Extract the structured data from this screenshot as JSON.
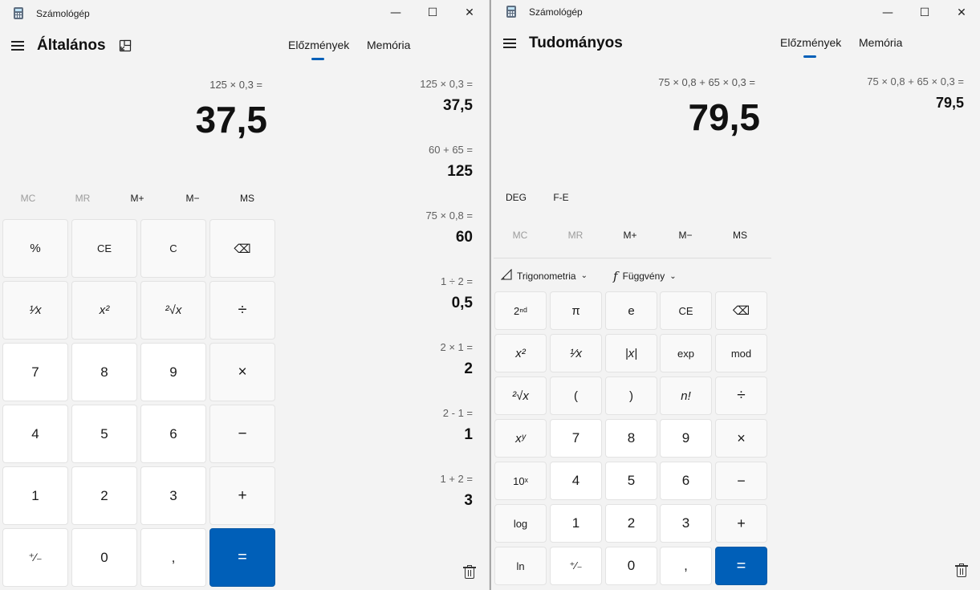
{
  "left": {
    "app_title": "Számológép",
    "mode": "Általános",
    "tabs": [
      "Előzmények",
      "Memória"
    ],
    "expression": "125 × 0,3 =",
    "display": "37,5",
    "memory": [
      "MC",
      "MR",
      "M+",
      "M−",
      "MS"
    ],
    "keys": [
      "%",
      "CE",
      "C",
      "⌫",
      "¹⁄x",
      "x²",
      "²√x",
      "÷",
      "7",
      "8",
      "9",
      "×",
      "4",
      "5",
      "6",
      "−",
      "1",
      "2",
      "3",
      "+",
      "⁺⁄₋",
      "0",
      ",",
      "="
    ],
    "history": [
      {
        "expr": "125   ×   0,3 =",
        "result": "37,5"
      },
      {
        "expr": "60   +   65 =",
        "result": "125"
      },
      {
        "expr": "75   ×   0,8 =",
        "result": "60"
      },
      {
        "expr": "1   ÷   2 =",
        "result": "0,5"
      },
      {
        "expr": "2   ×   1 =",
        "result": "2"
      },
      {
        "expr": "2   -   1 =",
        "result": "1"
      },
      {
        "expr": "1   +   2 =",
        "result": "3"
      }
    ]
  },
  "right": {
    "app_title": "Számológép",
    "mode": "Tudományos",
    "tabs": [
      "Előzmények",
      "Memória"
    ],
    "expression": "75 × 0,8 + 65 × 0,3 =",
    "display": "79,5",
    "angle": "DEG",
    "fe": "F-E",
    "memory": [
      "MC",
      "MR",
      "M+",
      "M−",
      "MS"
    ],
    "trig_label": "Trigonometria",
    "func_label": "Függvény",
    "keys": [
      "2ⁿᵈ",
      "π",
      "e",
      "CE",
      "⌫",
      "x²",
      "¹⁄x",
      "|x|",
      "exp",
      "mod",
      "²√x",
      "(",
      ")",
      "n!",
      "÷",
      "xʸ",
      "7",
      "8",
      "9",
      "×",
      "10ˣ",
      "4",
      "5",
      "6",
      "−",
      "log",
      "1",
      "2",
      "3",
      "+",
      "ln",
      "⁺⁄₋",
      "0",
      ",",
      "="
    ],
    "history": [
      {
        "expr": "75   ×   0,8   +   65   ×   0,3 =",
        "result": "79,5"
      }
    ]
  },
  "colors": {
    "accent": "#005fb8",
    "background": "#f3f3f3"
  },
  "icons": [
    "calculator-icon",
    "hamburger-icon",
    "keep-on-top-icon",
    "backspace-icon",
    "trash-icon",
    "minimize-icon",
    "maximize-icon",
    "close-icon",
    "trigonometry-icon",
    "function-icon",
    "chevron-down-icon"
  ]
}
